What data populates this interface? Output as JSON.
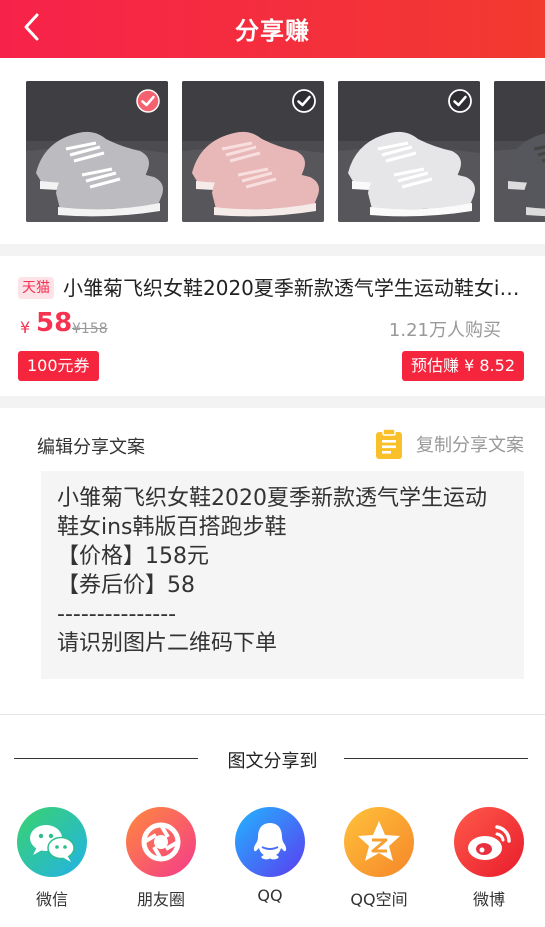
{
  "header": {
    "title": "分享赚"
  },
  "images": [
    {
      "checked": true,
      "shoe_color": "#bcbcc0",
      "sole": "#f3f3f3",
      "lace": "#ffffff"
    },
    {
      "checked": false,
      "shoe_color": "#e8b8b8",
      "sole": "#f5ecea",
      "lace": "#f8dede"
    },
    {
      "checked": false,
      "shoe_color": "#e6e6e8",
      "sole": "#fafafa",
      "lace": "#ffffff"
    },
    {
      "checked": false,
      "shoe_color": "#55575c",
      "sole": "#dcdcdc",
      "lace": "#444"
    }
  ],
  "product": {
    "shop_tag": "天猫",
    "title": "小雏菊飞织女鞋2020夏季新款透气学生运动鞋女ins韩版百搭跑步鞋",
    "price_symbol": "¥",
    "price": "58",
    "original_price": "¥158",
    "sold": "1.21万人购买",
    "coupon": "100元券",
    "estimated_earn": "预估赚 ¥ 8.52"
  },
  "copy": {
    "edit_label": "编辑分享文案",
    "copy_button": "复制分享文案",
    "lines": [
      "小雏菊飞织女鞋2020夏季新款透气学生运动鞋女ins韩版百搭跑步鞋",
      "【价格】158元",
      "【券后价】58",
      "---------------",
      "请识别图片二维码下单"
    ]
  },
  "share": {
    "title": "图文分享到",
    "targets": [
      {
        "label": "微信",
        "color_a": "#3ad36c",
        "color_b": "#22b2e8"
      },
      {
        "label": "朋友圈",
        "color_a": "#ff8a3c",
        "color_b": "#f43a8c"
      },
      {
        "label": "QQ",
        "color_a": "#22b5ff",
        "color_b": "#5b3cf0"
      },
      {
        "label": "QQ空间",
        "color_a": "#ffc23a",
        "color_b": "#f5862a"
      },
      {
        "label": "微博",
        "color_a": "#ff5a4a",
        "color_b": "#e81c2c"
      }
    ]
  },
  "colors": {
    "accent": "#f4253d",
    "price": "#f5324f"
  }
}
